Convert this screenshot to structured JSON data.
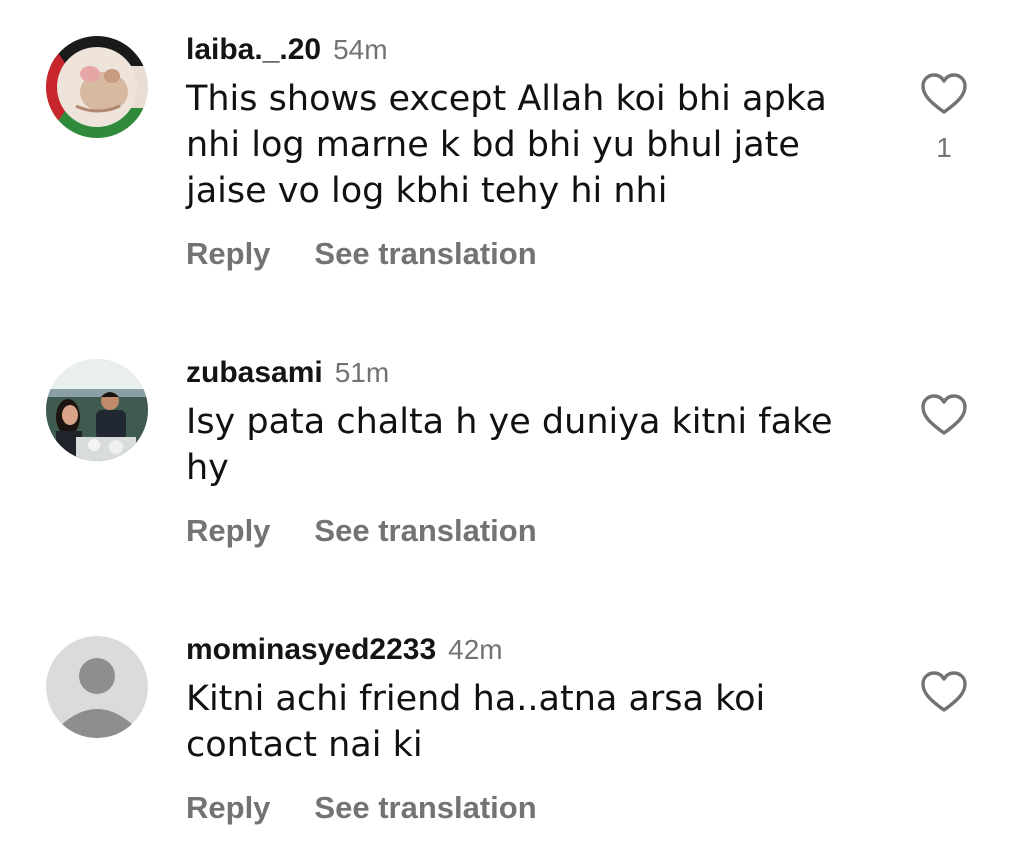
{
  "comments": [
    {
      "username": "laiba._.20",
      "time": "54m",
      "text_lines": [
        "This shows except Allah koi bhi apka",
        "nhi log marne k bd bhi yu bhul jate",
        "jaise vo log kbhi tehy hi nhi"
      ],
      "like_count": "1",
      "reply_label": "Reply",
      "translate_label": "See translation",
      "avatar": "profile-photo",
      "like_icon": "heart-outline-icon"
    },
    {
      "username": "zubasami",
      "time": "51m",
      "text_lines": [
        "Isy pata chalta h ye duniya kitni fake",
        "hy"
      ],
      "reply_label": "Reply",
      "translate_label": "See translation",
      "avatar": "profile-photo",
      "like_icon": "heart-outline-icon"
    },
    {
      "username": "mominasyed2233",
      "time": "42m",
      "text_lines": [
        "Kitni achi friend ha..atna arsa koi",
        "contact nai ki"
      ],
      "reply_label": "Reply",
      "translate_label": "See translation",
      "avatar": "default-avatar",
      "like_icon": "heart-outline-icon"
    }
  ],
  "colors": {
    "secondary_text": "#737373",
    "primary_text": "#141414",
    "default_avatar_bg": "#dbdbdb",
    "default_avatar_fg": "#f2f2f2"
  }
}
